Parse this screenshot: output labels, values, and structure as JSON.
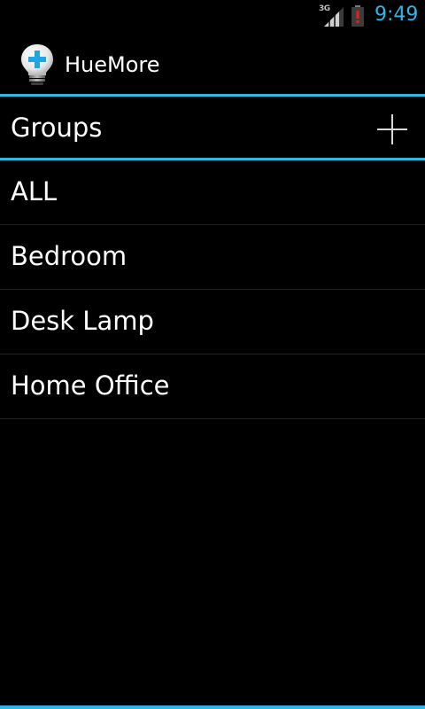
{
  "status_bar": {
    "network_type": "3G",
    "clock": "9:49",
    "signal_icon": "signal-bars-icon",
    "battery_icon": "battery-alert-icon",
    "accent_color": "#33b5e5"
  },
  "action_bar": {
    "app_icon": "lightbulb-plus-icon",
    "title": "HueMore"
  },
  "groups_header": {
    "title": "Groups",
    "add_icon": "plus-icon"
  },
  "groups": [
    {
      "label": "ALL"
    },
    {
      "label": "Bedroom"
    },
    {
      "label": "Desk Lamp"
    },
    {
      "label": "Home Office"
    }
  ]
}
